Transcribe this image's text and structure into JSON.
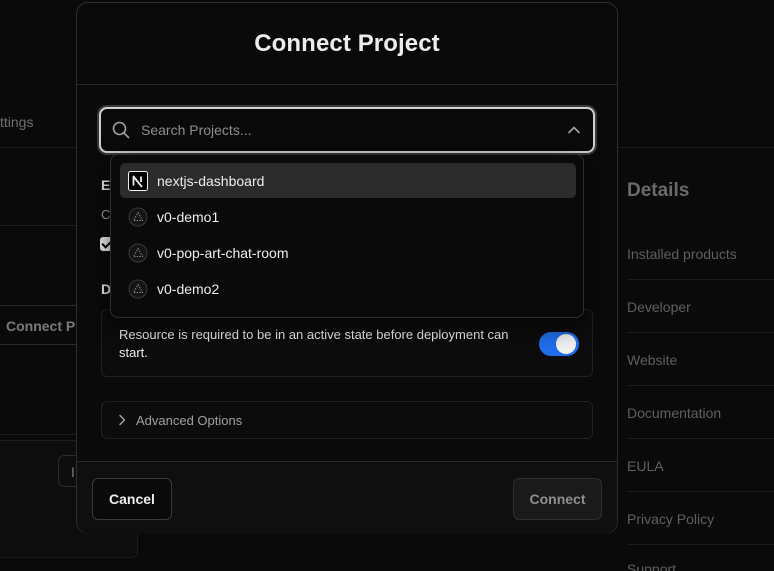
{
  "background": {
    "tab_label": "ttings",
    "connect_label": "Connect Pr",
    "small_btn_label": "I",
    "details": {
      "title": "Details",
      "items": [
        "Installed products",
        "Developer",
        "Website",
        "Documentation",
        "EULA",
        "Privacy Policy",
        "Support"
      ]
    }
  },
  "modal": {
    "title": "Connect Project",
    "search": {
      "placeholder": "Search Projects...",
      "value": ""
    },
    "under": {
      "env_label": "E",
      "env_text": "C",
      "deploy_label": "D"
    },
    "resource_card": {
      "text": "Resource is required to be in an active state before deployment can start.",
      "toggle_on": true
    },
    "advanced": {
      "label": "Advanced Options"
    },
    "dropdown": {
      "options": [
        {
          "label": "nextjs-dashboard",
          "icon": "nextjs-logo-icon",
          "highlighted": true
        },
        {
          "label": "v0-demo1",
          "icon": "triangle-icon",
          "highlighted": false
        },
        {
          "label": "v0-pop-art-chat-room",
          "icon": "triangle-icon",
          "highlighted": false
        },
        {
          "label": "v0-demo2",
          "icon": "triangle-icon",
          "highlighted": false
        }
      ]
    },
    "footer": {
      "cancel_label": "Cancel",
      "connect_label": "Connect"
    }
  },
  "colors": {
    "accent_toggle": "#1f6feb",
    "background": "#0a0a0a"
  }
}
